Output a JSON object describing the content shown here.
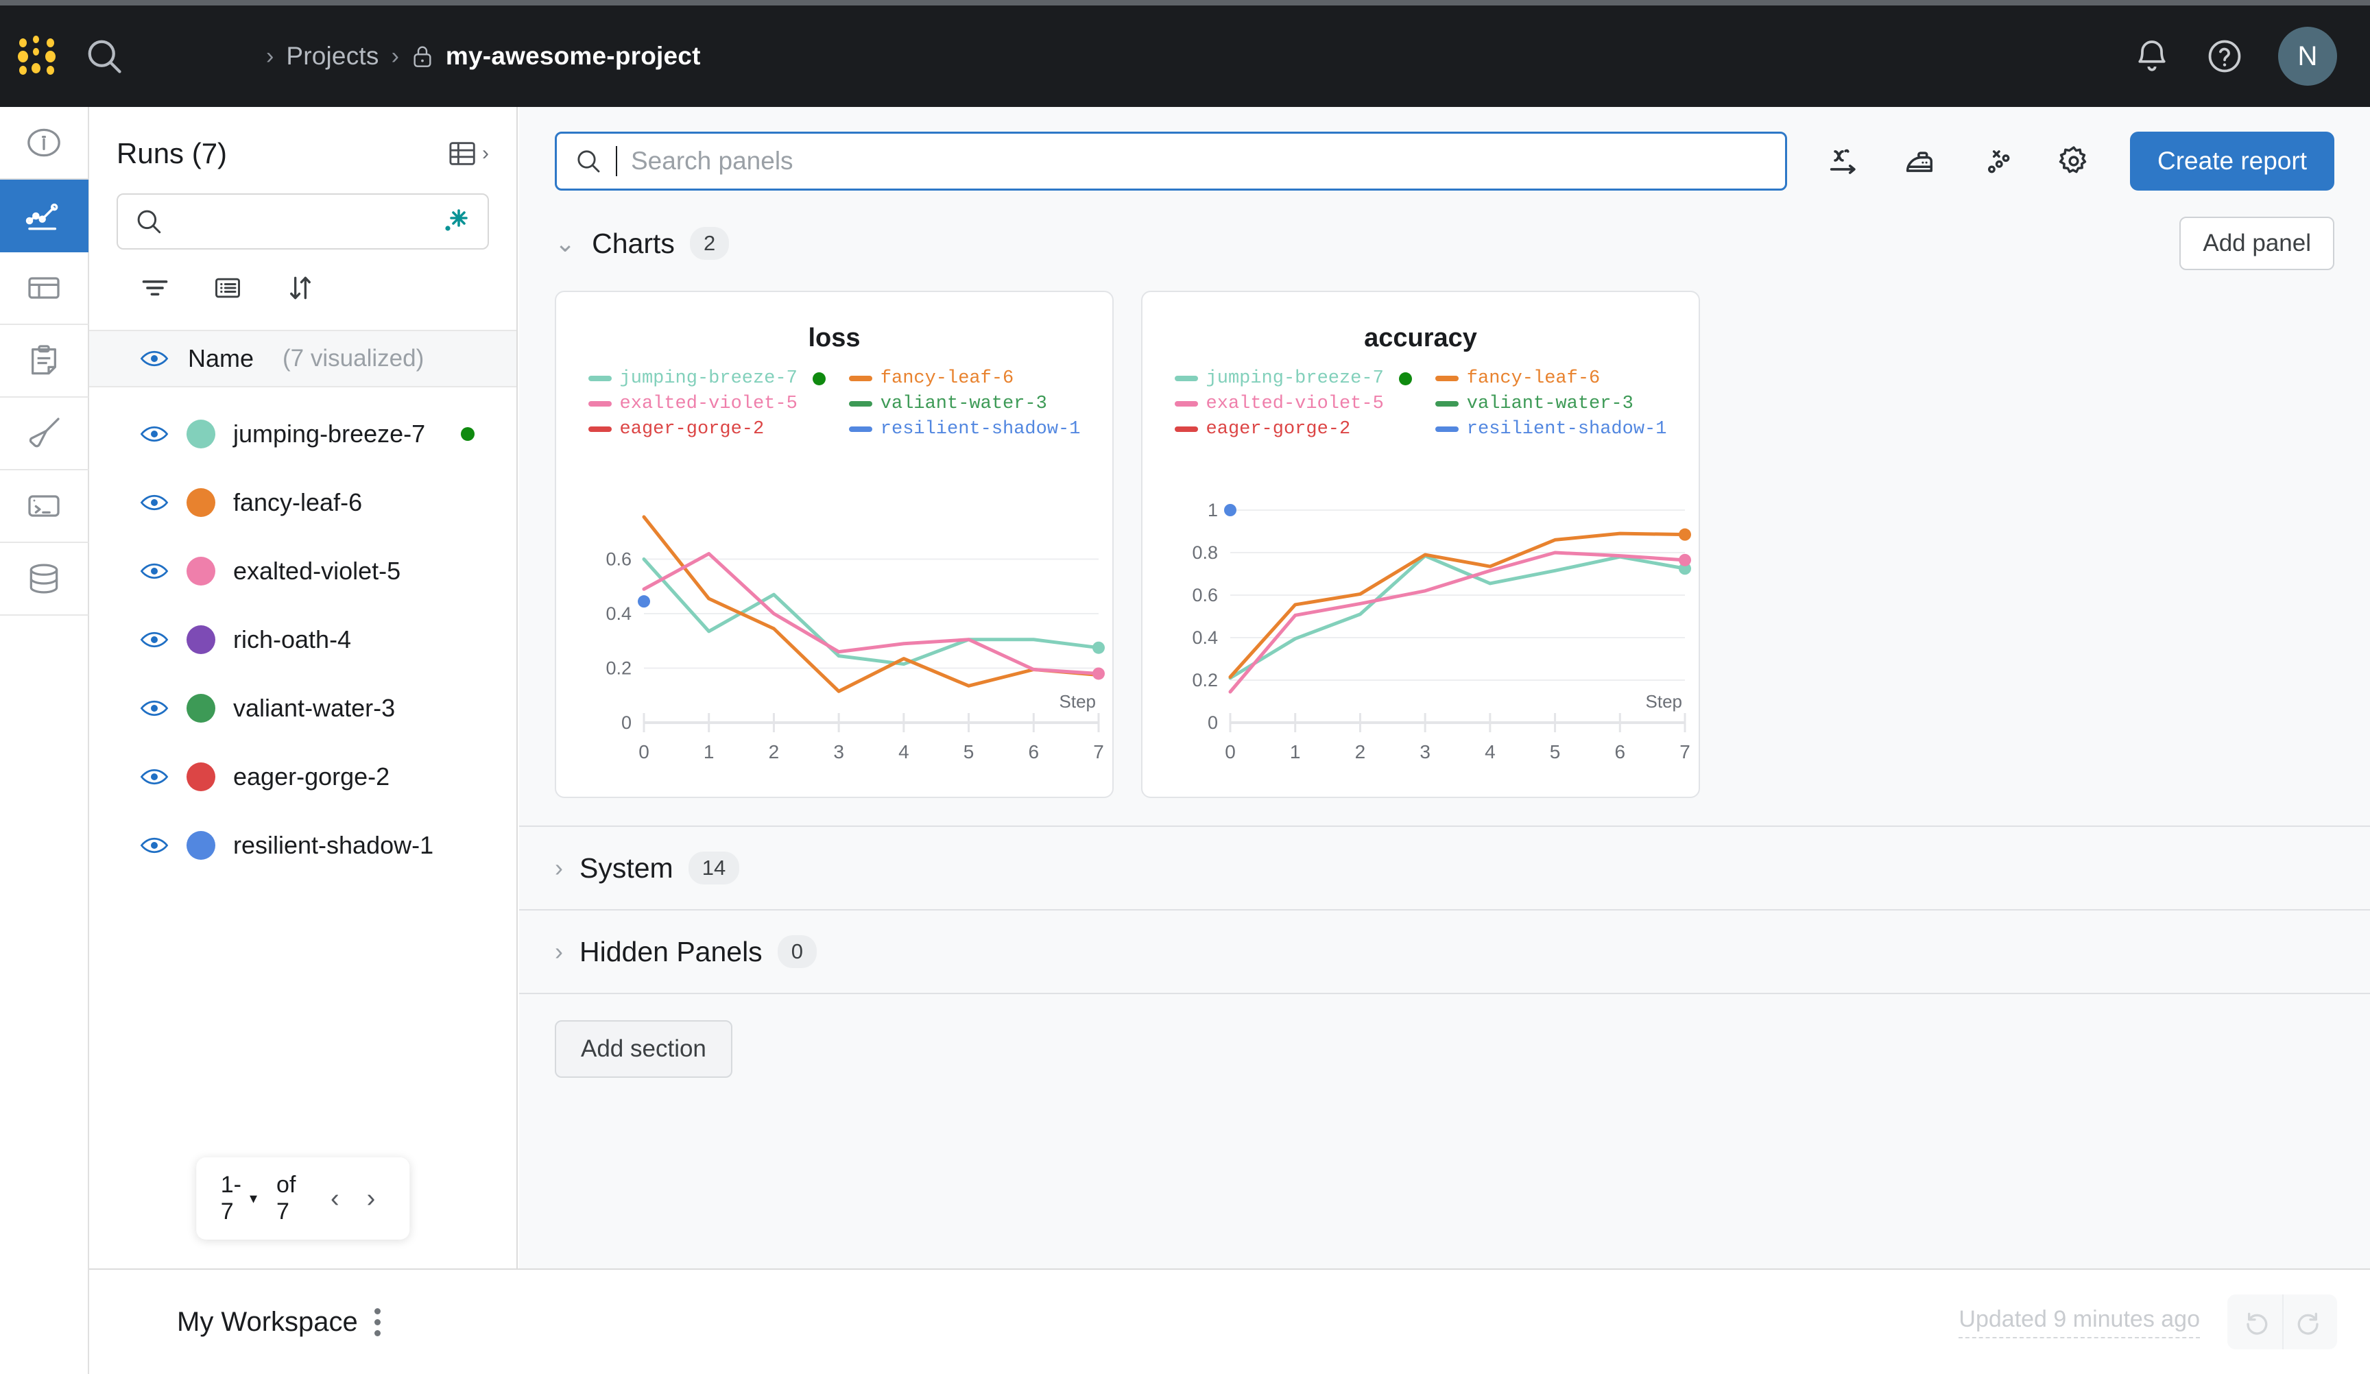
{
  "topnav": {
    "logo_name": "wandb-logo",
    "search_icon": "search-icon",
    "breadcrumb": {
      "sep": "›",
      "projects_label": "Projects",
      "lock_icon": "lock-icon",
      "project_label": "my-awesome-project"
    },
    "notifications_icon": "bell-icon",
    "help_icon": "help-circle-icon",
    "avatar_initial": "N",
    "avatar_color": "#4e6b7a",
    "background": "#1a1c1f"
  },
  "rail": {
    "items": [
      {
        "name": "info-icon",
        "active": false
      },
      {
        "name": "workspace-chart-icon",
        "active": true
      },
      {
        "name": "runs-table-icon",
        "active": false
      },
      {
        "name": "reports-clipboard-icon",
        "active": false
      },
      {
        "name": "sweeps-broom-icon",
        "active": false
      },
      {
        "name": "jobs-terminal-icon",
        "active": false
      },
      {
        "name": "artifacts-database-icon",
        "active": false
      }
    ],
    "active_color": "#2e78c7"
  },
  "sidebar": {
    "title": "Runs (7)",
    "table_toggle_icon": "table-expand-icon",
    "search_placeholder": "",
    "search_value": "",
    "search_icon": "search-icon",
    "sparkle_icon": "magic-sparkle-icon",
    "tools": [
      {
        "name": "filter-icon",
        "label": "Filter"
      },
      {
        "name": "columns-icon",
        "label": "Columns"
      },
      {
        "name": "sort-icon",
        "label": "Sort"
      }
    ],
    "name_header": {
      "eye_icon": "eye-visible-icon",
      "label": "Name",
      "sub": "(7 visualized)"
    },
    "runs": [
      {
        "name": "jumping-breeze-7",
        "color": "#82d0bb",
        "running": true
      },
      {
        "name": "fancy-leaf-6",
        "color": "#e8822e",
        "running": false
      },
      {
        "name": "exalted-violet-5",
        "color": "#ef7fab",
        "running": false
      },
      {
        "name": "rich-oath-4",
        "color": "#7d4bb5",
        "running": false
      },
      {
        "name": "valiant-water-3",
        "color": "#3d9a56",
        "running": false
      },
      {
        "name": "eager-gorge-2",
        "color": "#dc4545",
        "running": false
      },
      {
        "name": "resilient-shadow-1",
        "color": "#5287e0",
        "running": false
      }
    ],
    "pager": {
      "range": "1-7",
      "caret": "▾",
      "of": "of 7",
      "prev": "‹",
      "next": "›"
    }
  },
  "main": {
    "search": {
      "placeholder": "Search panels",
      "value": "",
      "icon": "search-icon",
      "focused": true,
      "focus_color": "#2e78c7"
    },
    "toolbar_icons": [
      {
        "name": "x-axis-icon"
      },
      {
        "name": "smoothing-iron-icon"
      },
      {
        "name": "outliers-scatter-icon"
      },
      {
        "name": "settings-gear-icon"
      }
    ],
    "create_report_label": "Create report",
    "sections": [
      {
        "title": "Charts",
        "count": "2",
        "expanded": true,
        "chevron": "⌄"
      },
      {
        "title": "System",
        "count": "14",
        "expanded": false,
        "chevron": "›"
      },
      {
        "title": "Hidden Panels",
        "count": "0",
        "expanded": false,
        "chevron": "›"
      }
    ],
    "add_panel_label": "Add panel",
    "add_section_label": "Add section"
  },
  "bottombar": {
    "workspace_label": "My Workspace",
    "kebab_icon": "more-vertical-icon",
    "updated_label": "Updated 9 minutes ago",
    "undo_icon": "undo-icon",
    "redo_icon": "redo-icon"
  },
  "chart_data": [
    {
      "type": "line",
      "title": "loss",
      "xlabel": "Step",
      "ylabel": "",
      "x": [
        0,
        1,
        2,
        3,
        4,
        5,
        6,
        7
      ],
      "xlim": [
        0,
        7
      ],
      "ylim": [
        0,
        0.78
      ],
      "yticks": [
        0,
        0.2,
        0.4,
        0.6
      ],
      "ytick_labels": [
        "0",
        "0.2",
        "0.4",
        "0.6"
      ],
      "xticks": [
        0,
        1,
        2,
        3,
        4,
        5,
        6,
        7
      ],
      "xtick_labels": [
        "0",
        "1",
        "2",
        "3",
        "4",
        "5",
        "6",
        "7"
      ],
      "grid": true,
      "legend_position": "top",
      "series": [
        {
          "name": "jumping-breeze-7",
          "color": "#82d0bb",
          "values": [
            0.6,
            0.335,
            0.47,
            0.245,
            0.215,
            0.305,
            0.305,
            0.275
          ],
          "end_marker": true
        },
        {
          "name": "fancy-leaf-6",
          "color": "#e8822e",
          "values": [
            0.755,
            0.455,
            0.345,
            0.115,
            0.235,
            0.135,
            0.195,
            0.175
          ],
          "end_marker": false
        },
        {
          "name": "exalted-violet-5",
          "color": "#ef7fab",
          "values": [
            0.49,
            0.62,
            0.4,
            0.26,
            0.29,
            0.305,
            0.195,
            0.18
          ],
          "end_marker": true
        },
        {
          "name": "valiant-water-3",
          "color": "#3d9a56",
          "values": [],
          "end_marker": false
        },
        {
          "name": "eager-gorge-2",
          "color": "#dc4545",
          "values": [],
          "end_marker": false
        },
        {
          "name": "resilient-shadow-1",
          "color": "#5287e0",
          "values": [
            0.445
          ],
          "end_marker": false
        }
      ]
    },
    {
      "type": "line",
      "title": "accuracy",
      "xlabel": "Step",
      "ylabel": "",
      "x": [
        0,
        1,
        2,
        3,
        4,
        5,
        6,
        7
      ],
      "xlim": [
        0,
        7
      ],
      "ylim": [
        0,
        1.0
      ],
      "yticks": [
        0,
        0.2,
        0.4,
        0.6,
        0.8,
        1
      ],
      "ytick_labels": [
        "0",
        "0.2",
        "0.4",
        "0.6",
        "0.8",
        "1"
      ],
      "xticks": [
        0,
        1,
        2,
        3,
        4,
        5,
        6,
        7
      ],
      "xtick_labels": [
        "0",
        "1",
        "2",
        "3",
        "4",
        "5",
        "6",
        "7"
      ],
      "grid": true,
      "legend_position": "top",
      "series": [
        {
          "name": "jumping-breeze-7",
          "color": "#82d0bb",
          "values": [
            0.21,
            0.395,
            0.51,
            0.785,
            0.655,
            0.715,
            0.78,
            0.725
          ],
          "end_marker": true
        },
        {
          "name": "fancy-leaf-6",
          "color": "#e8822e",
          "values": [
            0.215,
            0.555,
            0.605,
            0.79,
            0.735,
            0.86,
            0.89,
            0.885
          ],
          "end_marker": true
        },
        {
          "name": "exalted-violet-5",
          "color": "#ef7fab",
          "values": [
            0.145,
            0.505,
            0.56,
            0.62,
            0.715,
            0.8,
            0.785,
            0.765
          ],
          "end_marker": true
        },
        {
          "name": "valiant-water-3",
          "color": "#3d9a56",
          "values": [],
          "end_marker": false
        },
        {
          "name": "eager-gorge-2",
          "color": "#dc4545",
          "values": [],
          "end_marker": false
        },
        {
          "name": "resilient-shadow-1",
          "color": "#5287e0",
          "values": [
            1.0
          ],
          "end_marker": false
        }
      ]
    }
  ]
}
